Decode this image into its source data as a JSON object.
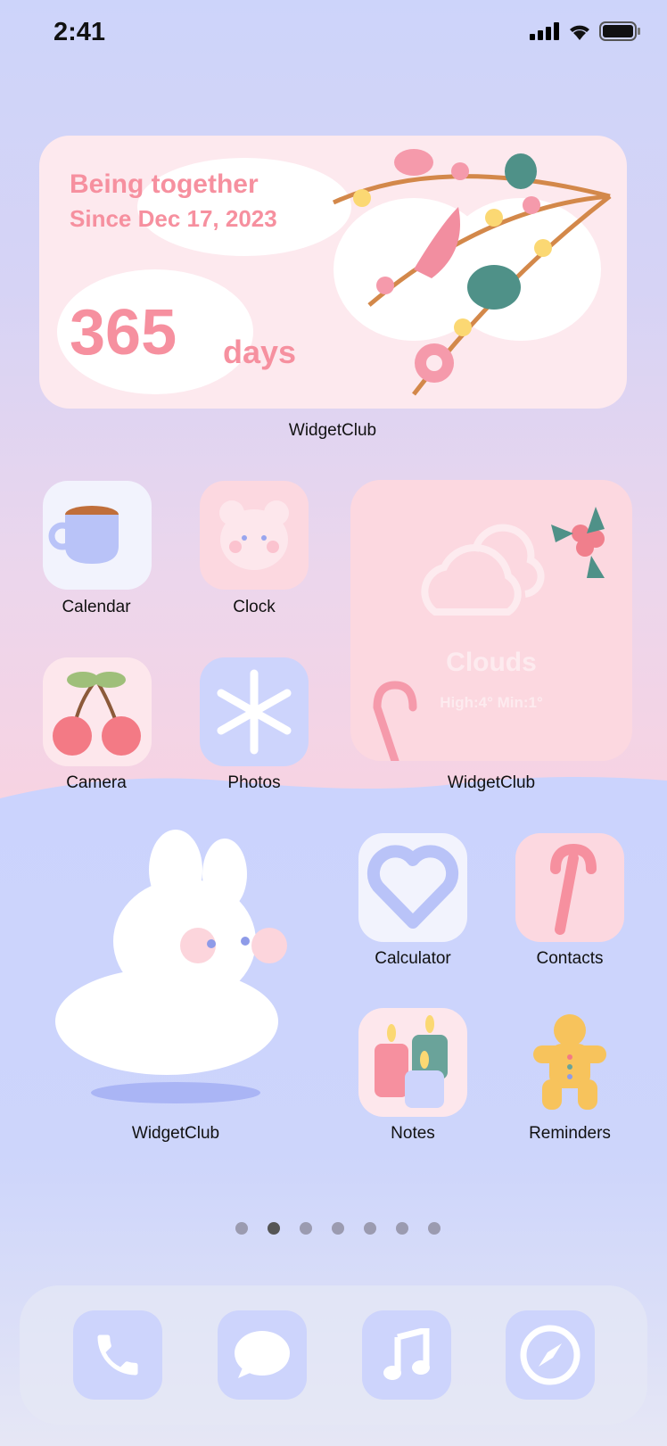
{
  "status_bar": {
    "time": "2:41",
    "icons": [
      "signal-icon",
      "wifi-icon",
      "battery-icon"
    ]
  },
  "anniversary_widget": {
    "line1": "Being together",
    "line2": "Since Dec 17, 2023",
    "count": "365",
    "unit": "days",
    "label": "WidgetClub"
  },
  "apps_row1": [
    {
      "label": "Calendar",
      "icon": "milk-cup-icon"
    },
    {
      "label": "Clock",
      "icon": "bear-icon"
    }
  ],
  "apps_row2": [
    {
      "label": "Camera",
      "icon": "cherry-icon"
    },
    {
      "label": "Photos",
      "icon": "snowflake-icon"
    }
  ],
  "weather_widget": {
    "condition": "Clouds",
    "range": "High:4° Min:1°",
    "label": "WidgetClub"
  },
  "bunny_widget": {
    "label": "WidgetClub"
  },
  "apps_row3": [
    {
      "label": "Calculator",
      "icon": "heart-icon"
    },
    {
      "label": "Contacts",
      "icon": "candy-cane-icon"
    }
  ],
  "apps_row4": [
    {
      "label": "Notes",
      "icon": "candles-icon"
    },
    {
      "label": "Reminders",
      "icon": "gingerbread-icon"
    }
  ],
  "page_dots": {
    "count": 7,
    "active": 2
  },
  "dock": [
    "phone-icon",
    "messages-icon",
    "music-icon",
    "safari-icon"
  ],
  "colors": {
    "pink_text": "#f6909f",
    "dock_icon": "#cdd4fc"
  }
}
